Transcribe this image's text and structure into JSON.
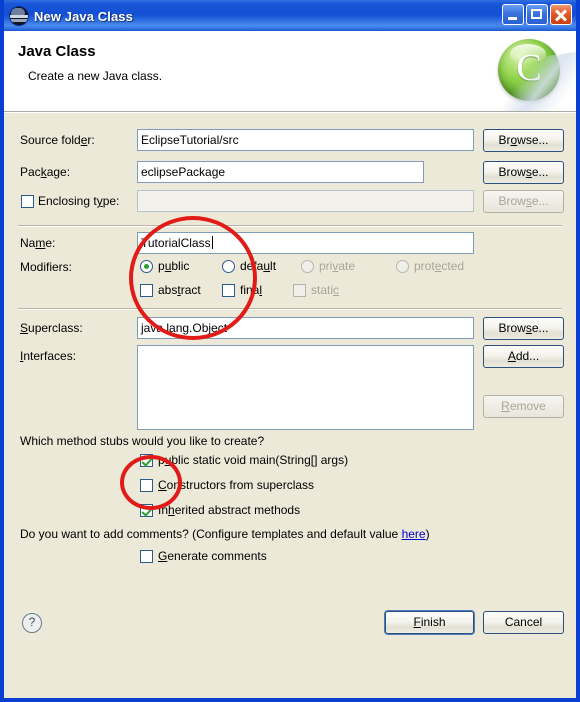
{
  "window": {
    "title": "New Java Class",
    "icon": "eclipse-globe-icon",
    "buttons": {
      "minimize": "minimize-icon",
      "maximize": "maximize-icon",
      "close": "close-icon"
    }
  },
  "header": {
    "title": "Java Class",
    "subtitle": "Create a new Java class.",
    "icon_letter": "C"
  },
  "form": {
    "source_folder": {
      "label_pre": "Source fold",
      "label_mn": "e",
      "label_post": "r:",
      "value": "EclipseTutorial/src",
      "browse": {
        "pre": "Br",
        "mn": "o",
        "post": "wse..."
      }
    },
    "package": {
      "label_pre": "Pac",
      "label_mn": "k",
      "label_post": "age:",
      "value": "eclipsePackage",
      "browse": {
        "pre": "Brow",
        "mn": "s",
        "post": "e..."
      }
    },
    "enclosing_type": {
      "label_pre": "Enclosing t",
      "label_mn": "y",
      "label_post": "pe:",
      "value": "",
      "checked": false,
      "enabled": false,
      "browse": {
        "pre": "Brow",
        "mn": "s",
        "post": "e..."
      }
    },
    "name": {
      "label_pre": "Na",
      "label_mn": "m",
      "label_post": "e:",
      "value": "TutorialClass"
    },
    "modifiers": {
      "label": "Modifiers:",
      "radios": [
        {
          "pre": "p",
          "mn": "u",
          "post": "blic",
          "selected": true,
          "enabled": true
        },
        {
          "pre": "defa",
          "mn": "u",
          "post": "lt",
          "selected": false,
          "enabled": true
        },
        {
          "pre": "pri",
          "mn": "v",
          "post": "ate",
          "selected": false,
          "enabled": false
        },
        {
          "pre": "prot",
          "mn": "e",
          "post": "cted",
          "selected": false,
          "enabled": false
        }
      ],
      "checkboxes": [
        {
          "pre": "abs",
          "mn": "t",
          "post": "ract",
          "checked": false,
          "enabled": true
        },
        {
          "pre": "fina",
          "mn": "l",
          "post": "",
          "checked": false,
          "enabled": true
        },
        {
          "pre": "stati",
          "mn": "c",
          "post": "",
          "checked": false,
          "enabled": false
        }
      ]
    },
    "superclass": {
      "label_pre": "",
      "label_mn": "S",
      "label_post": "uperclass:",
      "value": "java.lang.Object",
      "browse": {
        "pre": "Brow",
        "mn": "s",
        "post": "e..."
      }
    },
    "interfaces": {
      "label_pre": "",
      "label_mn": "I",
      "label_post": "nterfaces:",
      "items": [],
      "add": {
        "pre": "",
        "mn": "A",
        "post": "dd..."
      },
      "remove": {
        "pre": "",
        "mn": "R",
        "post": "emove",
        "enabled": false
      }
    }
  },
  "stubs": {
    "question": "Which method stubs would you like to create?",
    "options": [
      {
        "pre": "p",
        "mn": "u",
        "post": "blic static void main(String[] args)",
        "checked": true
      },
      {
        "pre": "",
        "mn": "C",
        "post": "onstructors from superclass",
        "checked": false
      },
      {
        "pre": "In",
        "mn": "h",
        "post": "erited abstract methods",
        "checked": true
      }
    ]
  },
  "comments": {
    "question_pre": "Do you want to add comments? (Configure templates and default value ",
    "link": "here",
    "question_post": ")",
    "checkbox": {
      "pre": "",
      "mn": "G",
      "post": "enerate comments",
      "checked": false
    }
  },
  "footer": {
    "help_icon": "?",
    "finish": {
      "pre": "",
      "mn": "F",
      "post": "inish"
    },
    "cancel": {
      "pre": "Cancel",
      "mn": "",
      "post": ""
    }
  },
  "annotations": {
    "color": "#e01b18",
    "ellipse_name_modifiers": "highlight-name-and-modifiers",
    "ellipse_main_method": "highlight-main-method-checkbox"
  }
}
